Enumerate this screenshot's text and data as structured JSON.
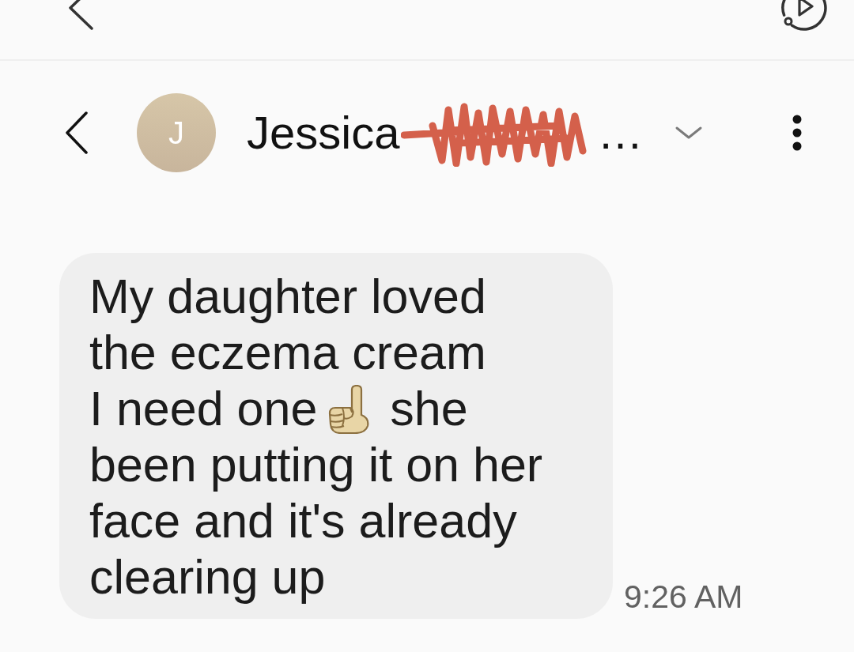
{
  "contact": {
    "initial": "J",
    "name": "Jessica",
    "redacted": true,
    "truncation": "…"
  },
  "messages": [
    {
      "sent": false,
      "lines": [
        [
          {
            "kind": "text",
            "text": "My daughter loved"
          }
        ],
        [
          {
            "kind": "text",
            "text": "the eczema cream"
          }
        ],
        [
          {
            "kind": "text",
            "text": "I need one"
          },
          {
            "kind": "emoji"
          },
          {
            "kind": "text",
            "text": "she"
          }
        ],
        [
          {
            "kind": "text",
            "text": "been putting it on her"
          }
        ],
        [
          {
            "kind": "text",
            "text": "face and it's already"
          }
        ],
        [
          {
            "kind": "text",
            "text": "clearing up"
          }
        ]
      ],
      "time": "9:26 AM"
    }
  ]
}
